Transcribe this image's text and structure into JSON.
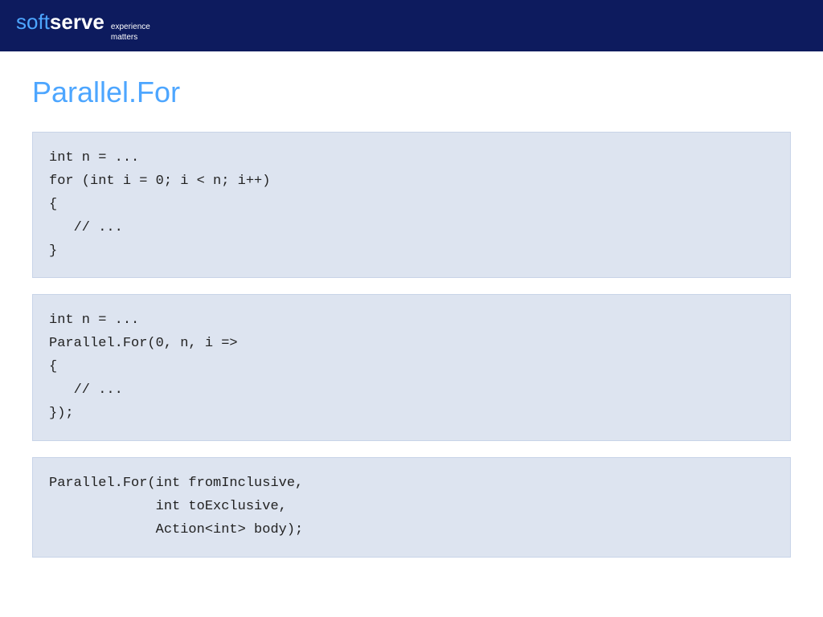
{
  "header": {
    "logo_soft": "soft",
    "logo_serve": "serve",
    "tagline_line1": "experience",
    "tagline_line2": "matters"
  },
  "page": {
    "title": "Parallel.For"
  },
  "code_blocks": [
    {
      "id": "block1",
      "code": "int n = ...\nfor (int i = 0; i < n; i++)\n{\n   // ...\n}"
    },
    {
      "id": "block2",
      "code": "int n = ...\nParallel.For(0, n, i =>\n{\n   // ...\n});"
    },
    {
      "id": "block3",
      "code": "Parallel.For(int fromInclusive,\n             int toExclusive,\n             Action<int> body);"
    }
  ]
}
